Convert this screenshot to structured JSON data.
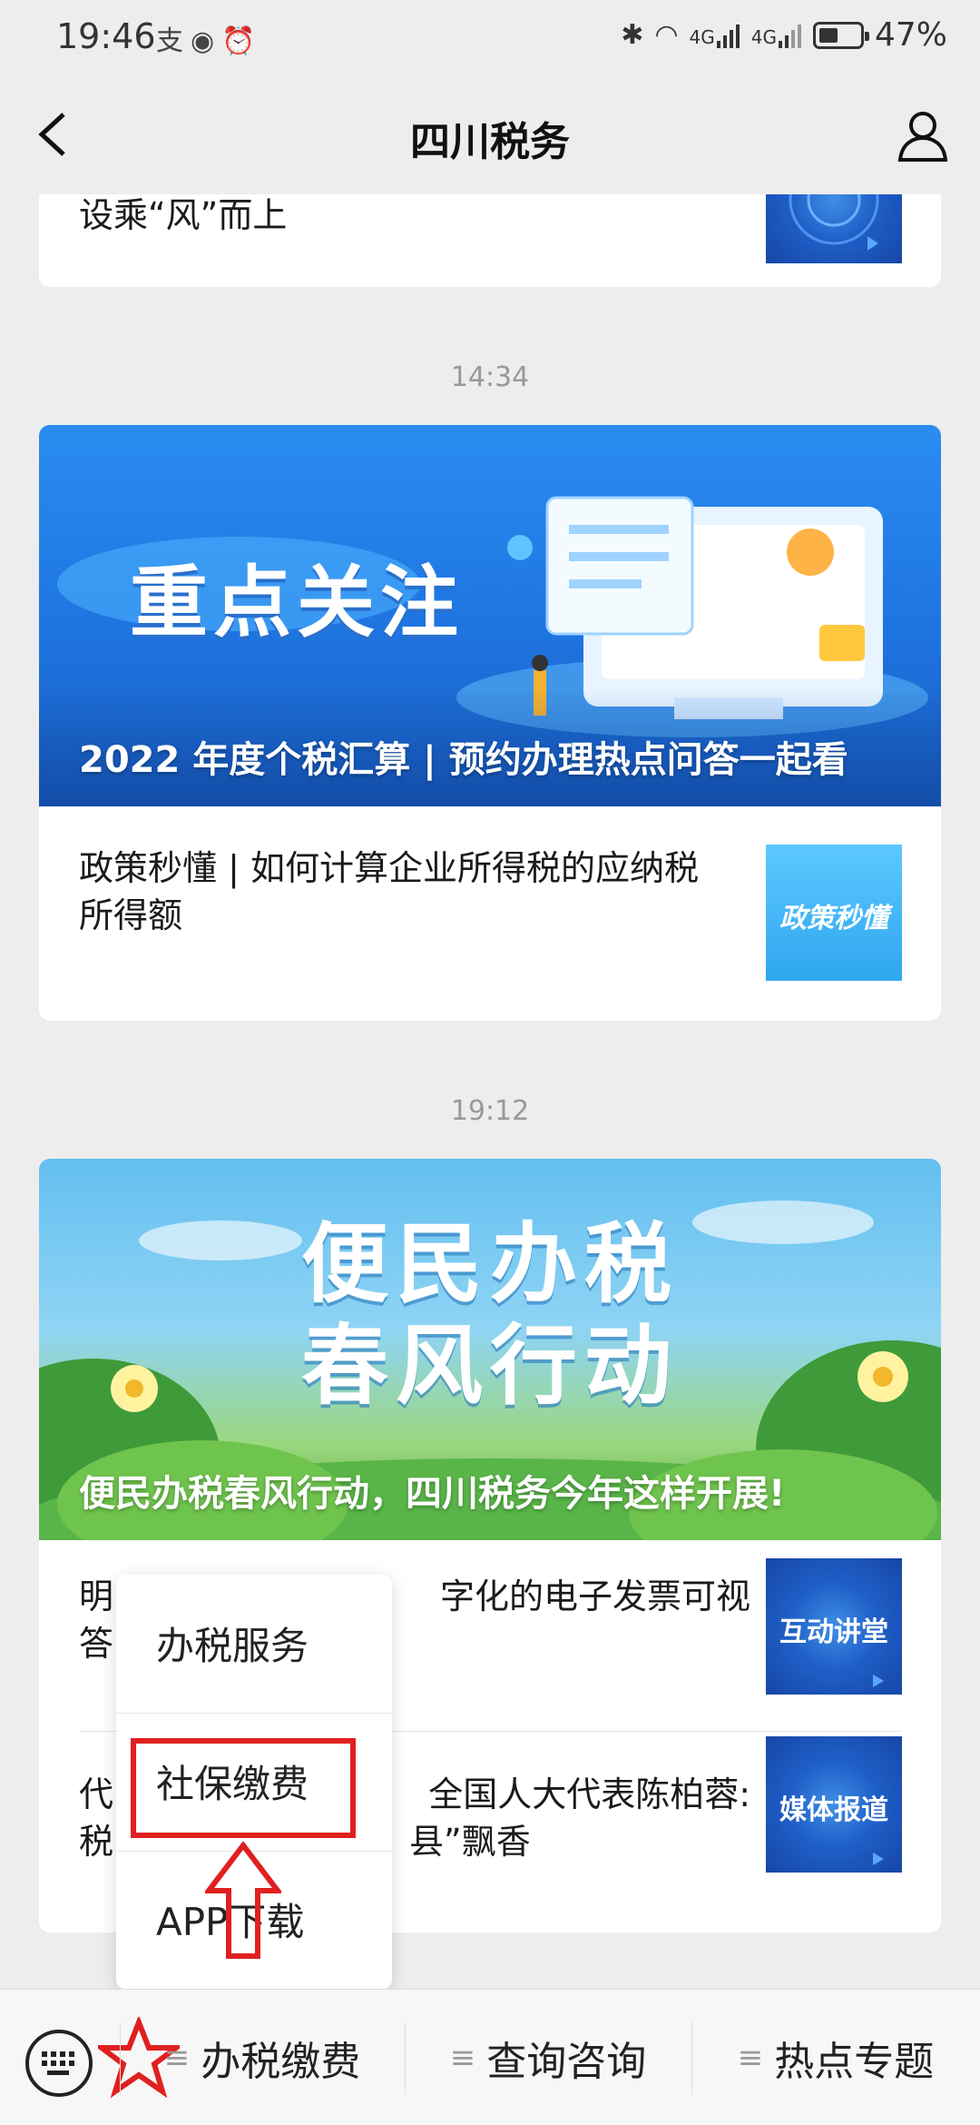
{
  "status_bar": {
    "time": "19:46",
    "left_icons": [
      "alipay-icon",
      "eye-icon",
      "alarm-icon"
    ],
    "right_icons": [
      "bluetooth-icon",
      "wifi-icon",
      "signal-4g-icon",
      "signal-4g-icon"
    ],
    "network_1": "4G",
    "network_2": "4G",
    "battery_percent": "47%",
    "battery_level": 0.47
  },
  "nav": {
    "title": "四川税务",
    "back_icon": "chevron-left-icon",
    "profile_icon": "user-icon"
  },
  "top_card": {
    "text": "设乘“风”而上"
  },
  "sections": [
    {
      "timestamp": "14:34",
      "banner_big_text": "重点关注",
      "banner_caption": "2022 年度个税汇算 | 预约办理热点问答一起看",
      "items": [
        {
          "text_line1": "政策秒懂 | 如何计算企业所得税的应纳税",
          "text_line2": "所得额",
          "thumb_label": "政策秒懂"
        }
      ]
    },
    {
      "timestamp": "19:12",
      "banner_big_line1": "便民办税",
      "banner_big_line2": "春风行动",
      "banner_caption": "便民办税春风行动，四川税务今年这样开展!",
      "items": [
        {
          "text_left_line1": "明",
          "text_left_line2": "答",
          "text_right_line1": "字化的电子发票可视",
          "thumb_label": "互动讲堂"
        },
        {
          "text_left_line1": "代",
          "text_left_line2": "税",
          "text_right_line1": "全国人大代表陈柏蓉:",
          "text_right_line2": "县”飘香",
          "thumb_label": "媒体报道"
        }
      ]
    }
  ],
  "popup_menu": {
    "items": [
      "办税服务",
      "社保缴费",
      "APP下载"
    ],
    "highlighted_index": 1
  },
  "bottom_bar": {
    "keyboard_icon": "keyboard-icon",
    "menus": [
      "办税缴费",
      "查询咨询",
      "热点专题"
    ]
  }
}
